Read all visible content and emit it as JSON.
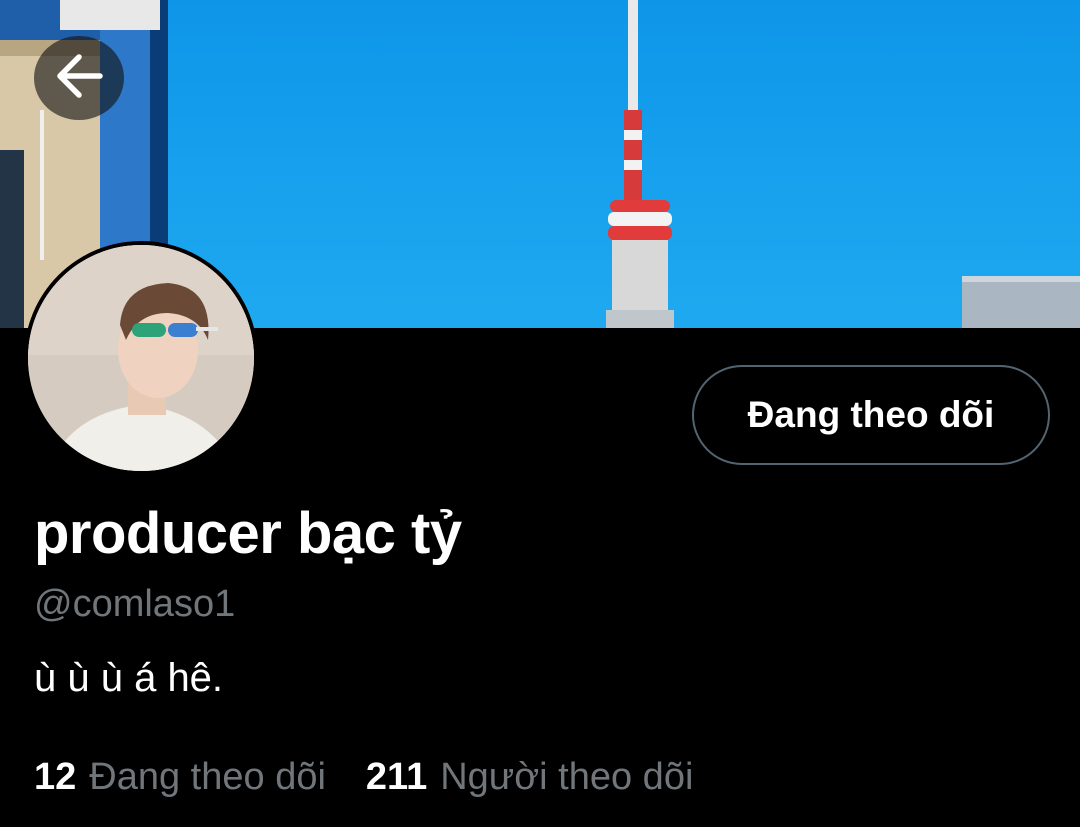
{
  "header": {
    "back_icon": "arrow-left-icon",
    "banner": "banner-photo-tower",
    "avatar": "profile-avatar-photo"
  },
  "profile": {
    "follow_button_label": "Đang theo dõi",
    "display_name": "producer bạc tỷ",
    "handle": "@comlaso1",
    "bio": "ù ù ù á hê."
  },
  "stats": {
    "following": {
      "count": "12",
      "label": "Đang theo dõi"
    },
    "followers": {
      "count": "211",
      "label": "Người theo dõi"
    }
  },
  "colors": {
    "background": "#000000",
    "sky": "#18a2ee",
    "secondary_text": "#71767b",
    "button_border": "#536471"
  }
}
